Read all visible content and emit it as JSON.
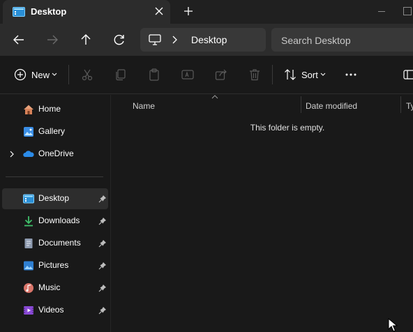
{
  "window": {
    "tab_title": "Desktop",
    "new_tab_icon": "plus-icon",
    "close_icon": "close-icon"
  },
  "address_bar": {
    "location": "Desktop",
    "search_placeholder": "Search Desktop"
  },
  "command_bar": {
    "new_label": "New",
    "sort_label": "Sort",
    "icons": [
      "cut-icon",
      "copy-icon",
      "paste-icon",
      "rename-icon",
      "share-icon",
      "delete-icon",
      "more-icon",
      "details-pane-icon"
    ]
  },
  "sidebar": {
    "items": [
      {
        "label": "Home",
        "icon": "home-icon"
      },
      {
        "label": "Gallery",
        "icon": "gallery-icon"
      },
      {
        "label": "OneDrive",
        "icon": "onedrive-icon"
      },
      {
        "label": "Desktop",
        "icon": "desktop-folder-icon",
        "pinned": true,
        "selected": true
      },
      {
        "label": "Downloads",
        "icon": "downloads-icon",
        "pinned": true
      },
      {
        "label": "Documents",
        "icon": "documents-icon",
        "pinned": true
      },
      {
        "label": "Pictures",
        "icon": "pictures-icon",
        "pinned": true
      },
      {
        "label": "Music",
        "icon": "music-icon",
        "pinned": true
      },
      {
        "label": "Videos",
        "icon": "videos-icon",
        "pinned": true
      }
    ]
  },
  "file_list": {
    "columns": [
      "Name",
      "Date modified",
      "Ty"
    ],
    "empty_message": "This folder is empty."
  },
  "colors": {
    "background": "#191919",
    "toolbar": "#2c2c2c",
    "field": "#383838",
    "selection": "#2d2d2d",
    "accent": "#4cc2ff"
  }
}
